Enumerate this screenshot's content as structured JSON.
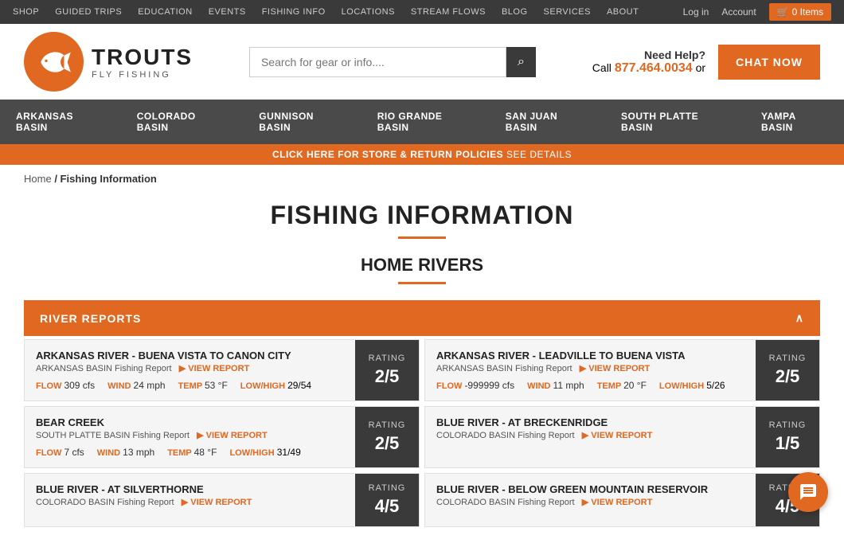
{
  "topNav": {
    "links": [
      "Shop",
      "Guided Trips",
      "Education",
      "Events",
      "Fishing Info",
      "Locations",
      "Stream Flows",
      "Blog",
      "Services",
      "About"
    ],
    "rightLinks": [
      "Log in",
      "Account"
    ],
    "cart": "0 Items"
  },
  "header": {
    "logoAlt": "Trouts Fly Fishing",
    "brandName": "TROUTS",
    "brandSub": "FLY FISHING",
    "searchPlaceholder": "Search for gear or info....",
    "searchIcon": "🔍",
    "needHelp": "Need Help?",
    "callText": "Call",
    "phone": "877.464.0034",
    "orText": "or",
    "chatNow": "CHAT NOW"
  },
  "basinNav": {
    "items": [
      "Arkansas Basin",
      "Colorado Basin",
      "Gunnison Basin",
      "Rio Grande Basin",
      "San Juan Basin",
      "South Platte Basin",
      "Yampa Basin"
    ]
  },
  "policyBar": {
    "boldText": "CLICK HERE FOR STORE & RETURN POLICIES",
    "normalText": " SEE DETAILS"
  },
  "breadcrumb": {
    "home": "Home",
    "separator": "/",
    "current": "Fishing Information"
  },
  "mainTitle": "FISHING INFORMATION",
  "sectionTitle": "HOME RIVERS",
  "riverReports": {
    "headerLabel": "RIVER REPORTS",
    "collapseIcon": "∧",
    "rivers": [
      {
        "name": "Arkansas River - Buena Vista to Canon City",
        "basin": "ARKANSAS BASIN Fishing Report",
        "viewReport": "VIEW REPORT",
        "rating": "2/5",
        "ratingLabel": "RATING",
        "flow": "309",
        "flowUnit": "cfs",
        "wind": "24",
        "windUnit": "mph",
        "temp": "53",
        "tempUnit": "°F",
        "lowHigh": "29/54"
      },
      {
        "name": "Arkansas River - Leadville to Buena Vista",
        "basin": "ARKANSAS BASIN Fishing Report",
        "viewReport": "VIEW REPORT",
        "rating": "2/5",
        "ratingLabel": "RATING",
        "flow": "-999999",
        "flowUnit": "cfs",
        "wind": "11",
        "windUnit": "mph",
        "temp": "20",
        "tempUnit": "°F",
        "lowHigh": "5/26"
      },
      {
        "name": "Bear Creek",
        "basin": "SOUTH PLATTE BASIN Fishing Report",
        "viewReport": "VIEW REPORT",
        "rating": "2/5",
        "ratingLabel": "RATING",
        "flow": "7",
        "flowUnit": "cfs",
        "wind": "13",
        "windUnit": "mph",
        "temp": "48",
        "tempUnit": "°F",
        "lowHigh": "31/49"
      },
      {
        "name": "Blue River - At Breckenridge",
        "basin": "COLORADO BASIN Fishing Report",
        "viewReport": "VIEW REPORT",
        "rating": "1/5",
        "ratingLabel": "RATING",
        "flow": "",
        "flowUnit": "",
        "wind": "",
        "windUnit": "",
        "temp": "",
        "tempUnit": "",
        "lowHigh": ""
      },
      {
        "name": "Blue River - At Silverthorne",
        "basin": "COLORADO BASIN Fishing Report",
        "viewReport": "VIEW REPORT",
        "rating": "4/5",
        "ratingLabel": "RATING",
        "flow": "",
        "flowUnit": "",
        "wind": "",
        "windUnit": "",
        "temp": "",
        "tempUnit": "",
        "lowHigh": ""
      },
      {
        "name": "Blue River - Below Green Mountain Reservoir",
        "basin": "COLORADO BASIN Fishing Report",
        "viewReport": "VIEW REPORT",
        "rating": "4/5",
        "ratingLabel": "RATING",
        "flow": "",
        "flowUnit": "",
        "wind": "",
        "windUnit": "",
        "temp": "",
        "tempUnit": "",
        "lowHigh": ""
      }
    ]
  },
  "colors": {
    "orange": "#e06820",
    "darkGray": "#3a3a3a",
    "navGray": "#4a4a4a"
  }
}
